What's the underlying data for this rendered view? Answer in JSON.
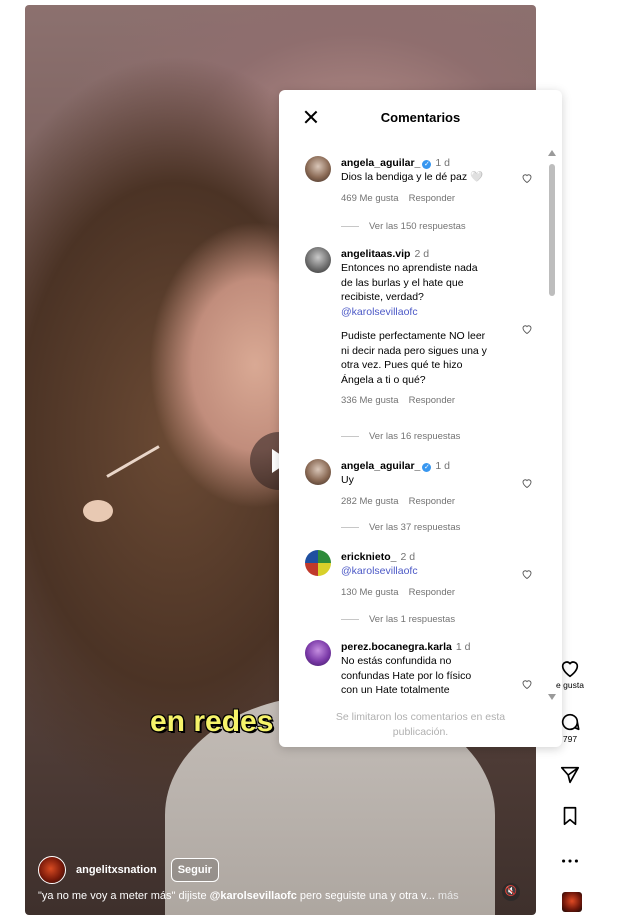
{
  "video": {
    "caption_overlay": "en redes",
    "author": {
      "username": "angelitxsnation",
      "follow_label": "Seguir"
    },
    "description": {
      "prefix": "\"ya no me voy a meter más\" dijiste ",
      "mention": "@karolsevillaofc",
      "suffix": " pero seguiste una y otra v...",
      "more": " más"
    }
  },
  "comments_panel": {
    "title": "Comentarios",
    "limit_note": "Se limitaron los comentarios en esta publicación.",
    "comments": [
      {
        "username": "angela_aguilar_",
        "verified": true,
        "time": "1 d",
        "text_lines": [
          "Dios la bendiga y le dé paz 🤍"
        ],
        "likes": "469 Me gusta",
        "reply_label": "Responder",
        "replies": "Ver las 150 respuestas"
      },
      {
        "username": "angelitaas.vip",
        "verified": false,
        "time": "2 d",
        "text_lines": [
          "Entonces no aprendiste nada",
          "de las burlas y el hate que",
          "recibiste, verdad?"
        ],
        "mention": "@karolsevillaofc",
        "text2_lines": [
          "Pudiste perfectamente NO leer",
          "ni decir nada pero sigues una y",
          "otra vez. Pues qué te hizo",
          "Ángela a ti o qué?"
        ],
        "likes": "336 Me gusta",
        "reply_label": "Responder",
        "replies": "Ver las 16 respuestas"
      },
      {
        "username": "angela_aguilar_",
        "verified": true,
        "time": "1 d",
        "text_lines": [
          "Uy"
        ],
        "likes": "282 Me gusta",
        "reply_label": "Responder",
        "replies": "Ver las 37 respuestas"
      },
      {
        "username": "ericknieto_",
        "verified": false,
        "time": "2 d",
        "mention": "@karolsevillaofc",
        "likes": "130 Me gusta",
        "reply_label": "Responder",
        "replies": "Ver las 1 respuestas"
      },
      {
        "username": "perez.bocanegra.karla",
        "verified": false,
        "time": "1 d",
        "text_lines": [
          "No estás confundida no",
          "confundas Hate por lo físico",
          "con un Hate totalmente"
        ]
      }
    ]
  },
  "sidebar": {
    "like_label": "e gusta",
    "comment_count": "797"
  }
}
